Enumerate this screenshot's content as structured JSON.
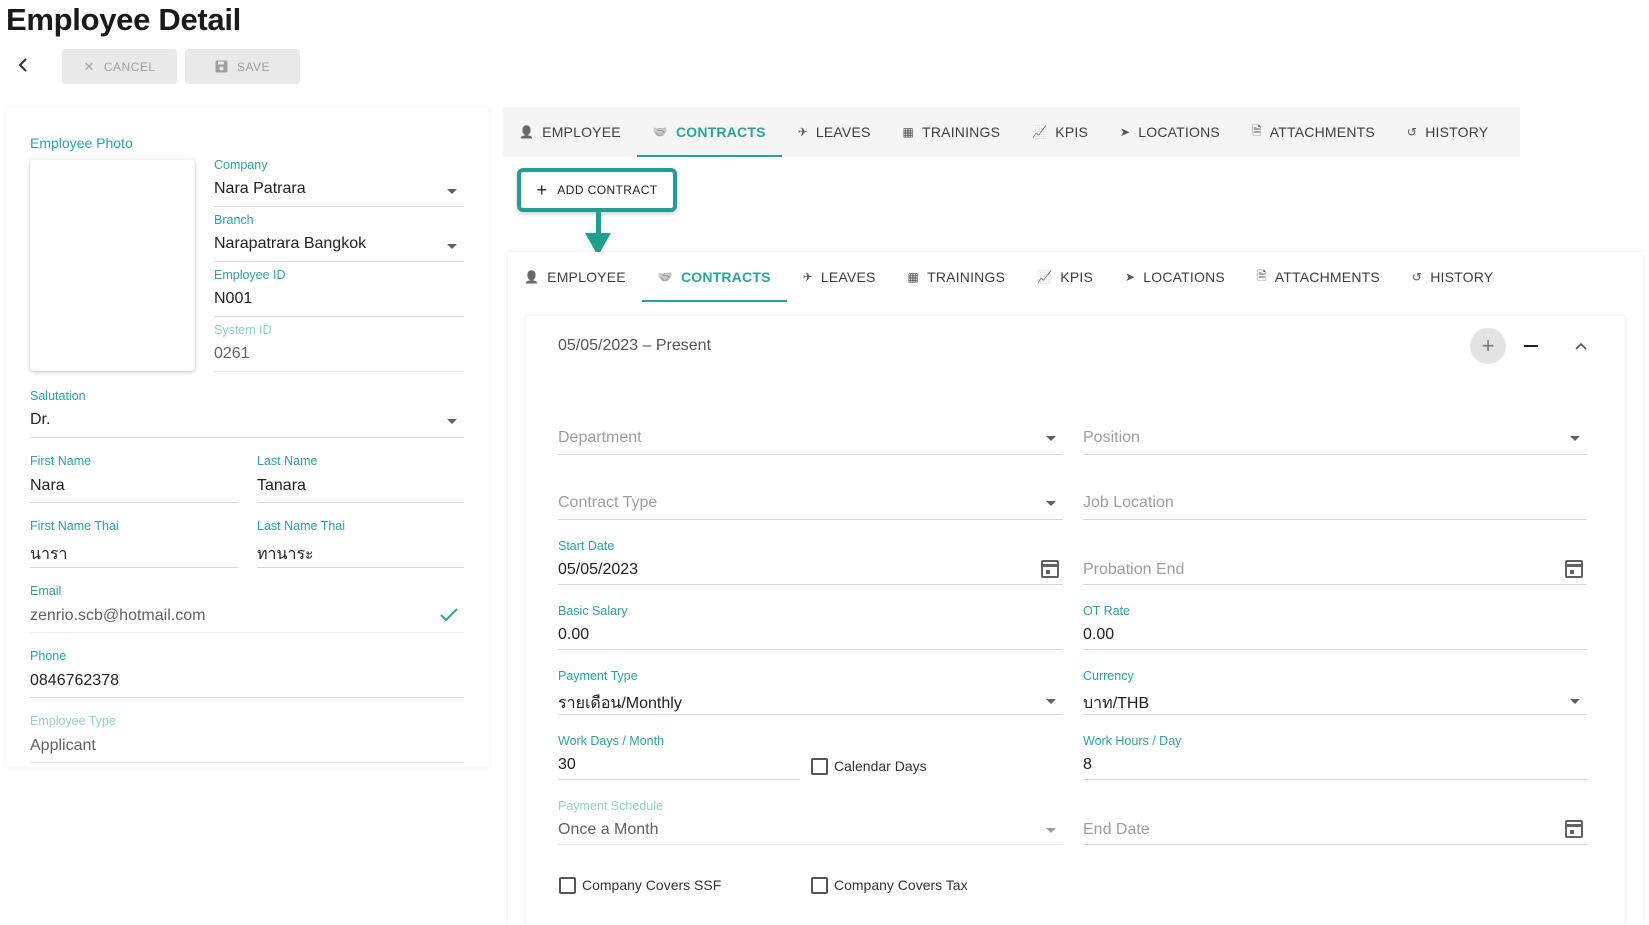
{
  "page": {
    "title": "Employee Detail"
  },
  "toolbar": {
    "cancel_label": "CANCEL",
    "save_label": "SAVE"
  },
  "profile": {
    "photo_label": "Employee Photo",
    "company": {
      "label": "Company",
      "value": "Nara Patrara"
    },
    "branch": {
      "label": "Branch",
      "value": "Narapatrara Bangkok"
    },
    "employee_id": {
      "label": "Employee ID",
      "value": "N001"
    },
    "system_id": {
      "label": "System ID",
      "value": "0261"
    },
    "salutation": {
      "label": "Salutation",
      "value": "Dr."
    },
    "first_name": {
      "label": "First Name",
      "value": "Nara"
    },
    "last_name": {
      "label": "Last Name",
      "value": "Tanara"
    },
    "first_name_thai": {
      "label": "First Name Thai",
      "value": "นารา"
    },
    "last_name_thai": {
      "label": "Last Name Thai",
      "value": "ทานาระ"
    },
    "email": {
      "label": "Email",
      "value": "zenrio.scb@hotmail.com"
    },
    "phone": {
      "label": "Phone",
      "value": "0846762378"
    },
    "employee_type": {
      "label": "Employee Type",
      "value": "Applicant"
    }
  },
  "tabs": [
    {
      "label": "EMPLOYEE",
      "icon": "person-icon"
    },
    {
      "label": "CONTRACTS",
      "icon": "handshake-icon",
      "active": true
    },
    {
      "label": "LEAVES",
      "icon": "plane-icon"
    },
    {
      "label": "TRAININGS",
      "icon": "calendar-icon"
    },
    {
      "label": "KPIS",
      "icon": "line-chart-icon"
    },
    {
      "label": "LOCATIONS",
      "icon": "location-arrow-icon"
    },
    {
      "label": "ATTACHMENTS",
      "icon": "file-icon"
    },
    {
      "label": "HISTORY",
      "icon": "history-icon"
    }
  ],
  "add_contract_label": "ADD CONTRACT",
  "contract": {
    "period": "05/05/2023 – Present",
    "department": {
      "placeholder": "Department"
    },
    "position": {
      "placeholder": "Position"
    },
    "contract_type": {
      "placeholder": "Contract Type"
    },
    "job_location": {
      "placeholder": "Job Location"
    },
    "start_date": {
      "label": "Start Date",
      "value": "05/05/2023"
    },
    "probation_end": {
      "placeholder": "Probation End"
    },
    "basic_salary": {
      "label": "Basic Salary",
      "value": "0.00"
    },
    "ot_rate": {
      "label": "OT Rate",
      "value": "0.00"
    },
    "payment_type": {
      "label": "Payment Type",
      "value": "รายเดือน/Monthly"
    },
    "currency": {
      "label": "Currency",
      "value": "บาท/THB"
    },
    "work_days": {
      "label": "Work Days / Month",
      "value": "30"
    },
    "calendar_days": {
      "label": "Calendar Days"
    },
    "work_hours": {
      "label": "Work Hours / Day",
      "value": "8"
    },
    "payment_schedule": {
      "label": "Payment Schedule",
      "value": "Once a Month"
    },
    "end_date": {
      "placeholder": "End Date"
    },
    "company_covers_ssf": {
      "label": "Company Covers SSF"
    },
    "company_covers_tax": {
      "label": "Company Covers Tax"
    }
  },
  "colors": {
    "accent": "#26a69a",
    "highlight": "#1fa08e"
  }
}
